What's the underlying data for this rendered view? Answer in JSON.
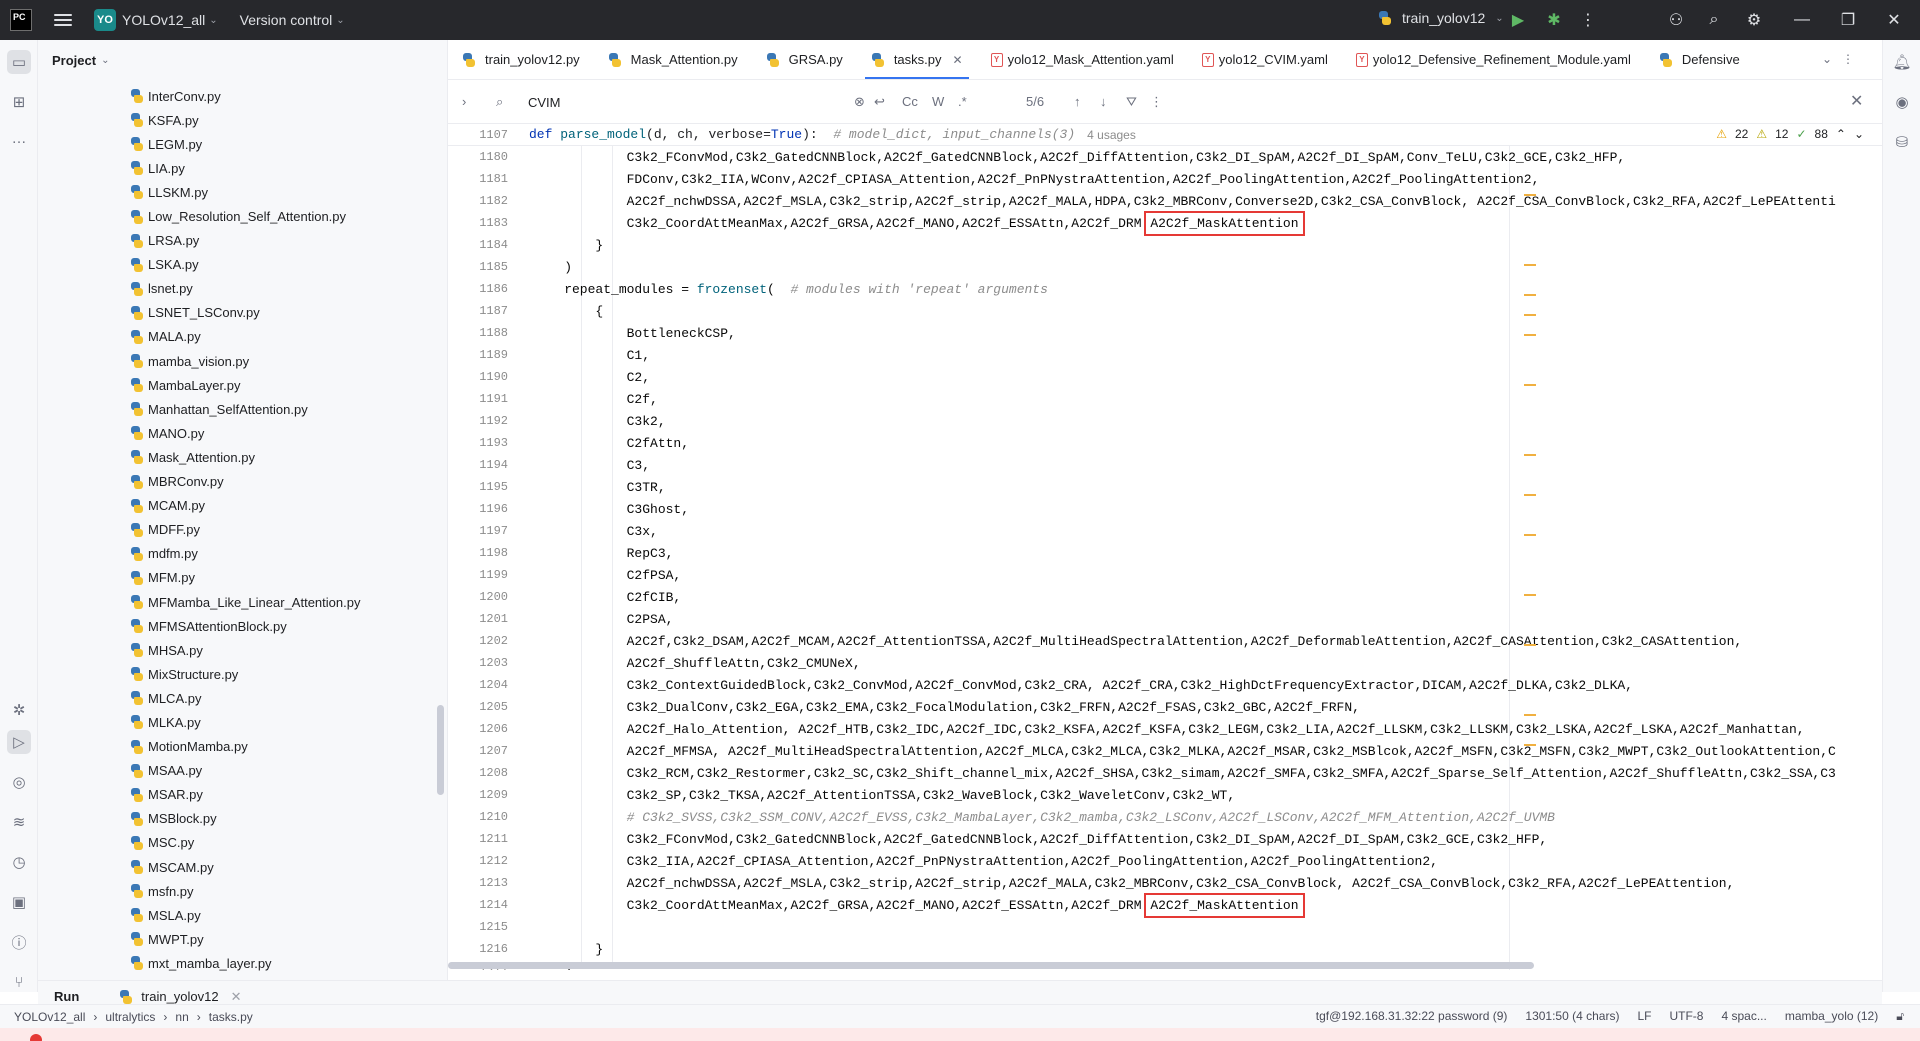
{
  "titlebar": {
    "app_logo": "PC",
    "project_badge": "YO",
    "project_name": "YOLOv12_all",
    "version_control": "Version control",
    "run_config": "train_yolov12"
  },
  "project_panel": {
    "title": "Project",
    "files": [
      "InterConv.py",
      "KSFA.py",
      "LEGM.py",
      "LIA.py",
      "LLSKM.py",
      "Low_Resolution_Self_Attention.py",
      "LRSA.py",
      "LSKA.py",
      "lsnet.py",
      "LSNET_LSConv.py",
      "MALA.py",
      "mamba_vision.py",
      "MambaLayer.py",
      "Manhattan_SelfAttention.py",
      "MANO.py",
      "Mask_Attention.py",
      "MBRConv.py",
      "MCAM.py",
      "MDFF.py",
      "mdfm.py",
      "MFM.py",
      "MFMamba_Like_Linear_Attention.py",
      "MFMSAttentionBlock.py",
      "MHSA.py",
      "MixStructure.py",
      "MLCA.py",
      "MLKA.py",
      "MotionMamba.py",
      "MSAA.py",
      "MSAR.py",
      "MSBlock.py",
      "MSC.py",
      "MSCAM.py",
      "msfn.py",
      "MSLA.py",
      "MWPT.py",
      "mxt_mamba_layer.py"
    ]
  },
  "tabs": [
    {
      "label": "train_yolov12.py",
      "kind": "py"
    },
    {
      "label": "Mask_Attention.py",
      "kind": "py"
    },
    {
      "label": "GRSA.py",
      "kind": "py"
    },
    {
      "label": "tasks.py",
      "kind": "py",
      "active": true
    },
    {
      "label": "yolo12_Mask_Attention.yaml",
      "kind": "yaml"
    },
    {
      "label": "yolo12_CVIM.yaml",
      "kind": "yaml"
    },
    {
      "label": "yolo12_Defensive_Refinement_Module.yaml",
      "kind": "yaml"
    },
    {
      "label": "Defensive",
      "kind": "py"
    }
  ],
  "search": {
    "query": "CVIM",
    "match_case": "Cc",
    "words": "W",
    "regex": ".*",
    "count": "5/6"
  },
  "editor": {
    "sticky_line_no": "1107",
    "sticky_kw": "def",
    "sticky_fn": "parse_model",
    "sticky_args": "(d, ch, verbose=",
    "sticky_true": "True",
    "sticky_end": "):",
    "sticky_comment": "# model_dict, input_channels(3)",
    "sticky_usages": "4 usages",
    "warnings": "22",
    "weak_warnings": "12",
    "ok_count": "88",
    "highlight_text": "A2C2f_MaskAttention",
    "lines": [
      {
        "no": "1180",
        "text": "            C3k2_FConvMod,C3k2_GatedCNNBlock,A2C2f_GatedCNNBlock,A2C2f_DiffAttention,C3k2_DI_SpAM,A2C2f_DI_SpAM,Conv_TeLU,C3k2_GCE,C3k2_HFP,"
      },
      {
        "no": "1181",
        "text": "            FDConv,C3k2_IIA,WConv,A2C2f_CPIASA_Attention,A2C2f_PnPNystraAttention,A2C2f_PoolingAttention,A2C2f_PoolingAttention2,"
      },
      {
        "no": "1182",
        "text": "            A2C2f_nchwDSSA,A2C2f_MSLA,C3k2_strip,A2C2f_strip,A2C2f_MALA,HDPA,C3k2_MBRConv,Converse2D,C3k2_CSA_ConvBlock, A2C2f_CSA_ConvBlock,C3k2_RFA,A2C2f_LePEAttenti"
      },
      {
        "no": "1183",
        "text": "            C3k2_CoordAttMeanMax,A2C2f_GRSA,A2C2f_MANO,A2C2f_ESSAttn,A2C2f_DRM ",
        "hl": true
      },
      {
        "no": "1184",
        "text": "        }"
      },
      {
        "no": "1185",
        "text": "    )"
      },
      {
        "no": "1186",
        "text": "    repeat_modules = ",
        "fz": true
      },
      {
        "no": "1187",
        "text": "        {"
      },
      {
        "no": "1188",
        "text": "            BottleneckCSP,"
      },
      {
        "no": "1189",
        "text": "            C1,"
      },
      {
        "no": "1190",
        "text": "            C2,"
      },
      {
        "no": "1191",
        "text": "            C2f,"
      },
      {
        "no": "1192",
        "text": "            C3k2,"
      },
      {
        "no": "1193",
        "text": "            C2fAttn,"
      },
      {
        "no": "1194",
        "text": "            C3,"
      },
      {
        "no": "1195",
        "text": "            C3TR,"
      },
      {
        "no": "1196",
        "text": "            C3Ghost,"
      },
      {
        "no": "1197",
        "text": "            C3x,"
      },
      {
        "no": "1198",
        "text": "            RepC3,"
      },
      {
        "no": "1199",
        "text": "            C2fPSA,"
      },
      {
        "no": "1200",
        "text": "            C2fCIB,"
      },
      {
        "no": "1201",
        "text": "            C2PSA,"
      },
      {
        "no": "1202",
        "text": "            A2C2f,C3k2_DSAM,A2C2f_MCAM,A2C2f_AttentionTSSA,A2C2f_MultiHeadSpectralAttention,A2C2f_DeformableAttention,A2C2f_CASAttention,C3k2_CASAttention,"
      },
      {
        "no": "1203",
        "text": "            A2C2f_ShuffleAttn,C3k2_CMUNeX,"
      },
      {
        "no": "1204",
        "text": "            C3k2_ContextGuidedBlock,C3k2_ConvMod,A2C2f_ConvMod,C3k2_CRA, A2C2f_CRA,C3k2_HighDctFrequencyExtractor,DICAM,A2C2f_DLKA,C3k2_DLKA,"
      },
      {
        "no": "1205",
        "text": "            C3k2_DualConv,C3k2_EGA,C3k2_EMA,C3k2_FocalModulation,C3k2_FRFN,A2C2f_FSAS,C3k2_GBC,A2C2f_FRFN,"
      },
      {
        "no": "1206",
        "text": "            A2C2f_Halo_Attention, A2C2f_HTB,C3k2_IDC,A2C2f_IDC,C3k2_KSFA,A2C2f_KSFA,C3k2_LEGM,C3k2_LIA,A2C2f_LLSKM,C3k2_LLSKM,C3k2_LSKA,A2C2f_LSKA,A2C2f_Manhattan,"
      },
      {
        "no": "1207",
        "text": "            A2C2f_MFMSA, A2C2f_MultiHeadSpectralAttention,A2C2f_MLCA,C3k2_MLCA,C3k2_MLKA,A2C2f_MSAR,C3k2_MSBlcok,A2C2f_MSFN,C3k2_MSFN,C3k2_MWPT,C3k2_OutlookAttention,C"
      },
      {
        "no": "1208",
        "text": "            C3k2_RCM,C3k2_Restormer,C3k2_SC,C3k2_Shift_channel_mix,A2C2f_SHSA,C3k2_simam,A2C2f_SMFA,C3k2_SMFA,A2C2f_Sparse_Self_Attention,A2C2f_ShuffleAttn,C3k2_SSA,C3"
      },
      {
        "no": "1209",
        "text": "            C3k2_SP,C3k2_TKSA,A2C2f_AttentionTSSA,C3k2_WaveBlock,C3k2_WaveletConv,C3k2_WT,"
      },
      {
        "no": "1210",
        "text": "            # C3k2_SVSS,C3k2_SSM_CONV,A2C2f_EVSS,C3k2_MambaLayer,C3k2_mamba,C3k2_LSConv,A2C2f_LSConv,A2C2f_MFM_Attention,A2C2f_UVMB",
        "comment": true
      },
      {
        "no": "1211",
        "text": "            C3k2_FConvMod,C3k2_GatedCNNBlock,A2C2f_GatedCNNBlock,A2C2f_DiffAttention,C3k2_DI_SpAM,A2C2f_DI_SpAM,C3k2_GCE,C3k2_HFP,"
      },
      {
        "no": "1212",
        "text": "            C3k2_IIA,A2C2f_CPIASA_Attention,A2C2f_PnPNystraAttention,A2C2f_PoolingAttention,A2C2f_PoolingAttention2,"
      },
      {
        "no": "1213",
        "text": "            A2C2f_nchwDSSA,A2C2f_MSLA,C3k2_strip,A2C2f_strip,A2C2f_MALA,C3k2_MBRConv,C3k2_CSA_ConvBlock, A2C2f_CSA_ConvBlock,C3k2_RFA,A2C2f_LePEAttention,"
      },
      {
        "no": "1214",
        "text": "            C3k2_CoordAttMeanMax,A2C2f_GRSA,A2C2f_MANO,A2C2f_ESSAttn,A2C2f_DRM ",
        "hl": true
      },
      {
        "no": "1215",
        "text": ""
      },
      {
        "no": "1216",
        "text": "        }"
      },
      {
        "no": "1217",
        "text": "    )"
      }
    ],
    "frozenset_kw": "frozenset",
    "frozenset_tail": "(  ",
    "frozenset_comment": "# modules with 'repeat' arguments"
  },
  "runbar": {
    "label": "Run",
    "tab": "train_yolov12"
  },
  "statusbar": {
    "breadcrumb": [
      "YOLOv12_all",
      "ultralytics",
      "nn",
      "tasks.py"
    ],
    "interpreter_remote": "tgf@192.168.31.32:22 password (9)",
    "position": "1301:50 (4 chars)",
    "line_sep": "LF",
    "encoding": "UTF-8",
    "indent": "4 spac...",
    "env": "mamba_yolo (12)"
  }
}
